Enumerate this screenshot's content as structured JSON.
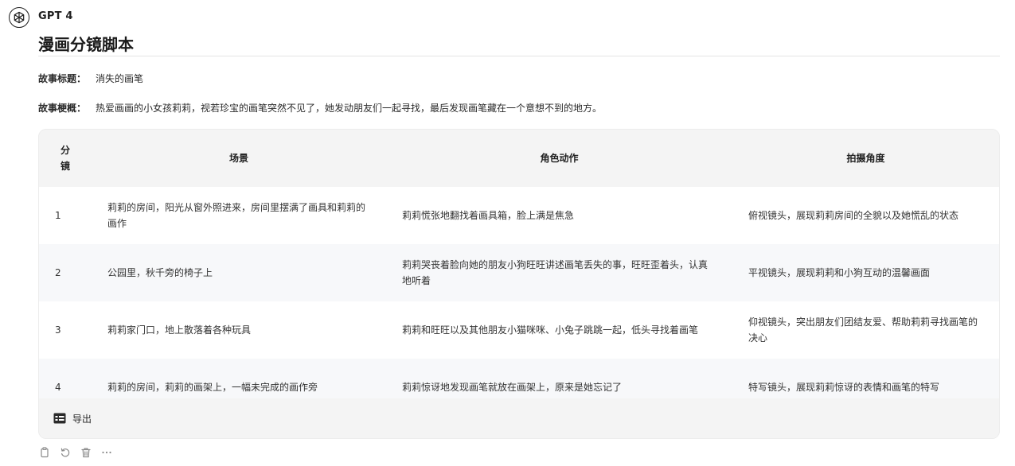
{
  "header": {
    "model_name": "GPT 4",
    "icon": "openai-logo-icon"
  },
  "document": {
    "title": "漫画分镜脚本",
    "story_title_label": "故事标题：",
    "story_title_value": "消失的画笔",
    "story_summary_label": "故事梗概：",
    "story_summary_value": "热爱画画的小女孩莉莉，视若珍宝的画笔突然不见了，她发动朋友们一起寻找，最后发现画笔藏在一个意想不到的地方。"
  },
  "table": {
    "headers": {
      "index_line1": "分",
      "index_line2": "镜",
      "scene": "场景",
      "action": "角色动作",
      "angle": "拍摄角度"
    },
    "rows": [
      {
        "index": "1",
        "scene": "莉莉的房间，阳光从窗外照进来，房间里摆满了画具和莉莉的画作",
        "action": "莉莉慌张地翻找着画具箱，脸上满是焦急",
        "angle": "俯视镜头，展现莉莉房间的全貌以及她慌乱的状态"
      },
      {
        "index": "2",
        "scene": "公园里，秋千旁的椅子上",
        "action": "莉莉哭丧着脸向她的朋友小狗旺旺讲述画笔丢失的事，旺旺歪着头，认真地听着",
        "angle": "平视镜头，展现莉莉和小狗互动的温馨画面"
      },
      {
        "index": "3",
        "scene": "莉莉家门口，地上散落着各种玩具",
        "action": "莉莉和旺旺以及其他朋友小猫咪咪、小兔子跳跳一起，低头寻找着画笔",
        "angle": "仰视镜头，突出朋友们团结友爱、帮助莉莉寻找画笔的决心"
      },
      {
        "index": "4",
        "scene": "莉莉的房间，莉莉的画架上，一幅未完成的画作旁",
        "action": "莉莉惊讶地发现画笔就放在画架上，原来是她忘记了",
        "angle": "特写镜头，展现莉莉惊讶的表情和画笔的特写"
      }
    ],
    "export_label": "导出",
    "export_icon": "table-icon"
  },
  "actions": {
    "icons": [
      "copy-icon",
      "regenerate-icon",
      "delete-icon",
      "more-icon"
    ]
  }
}
